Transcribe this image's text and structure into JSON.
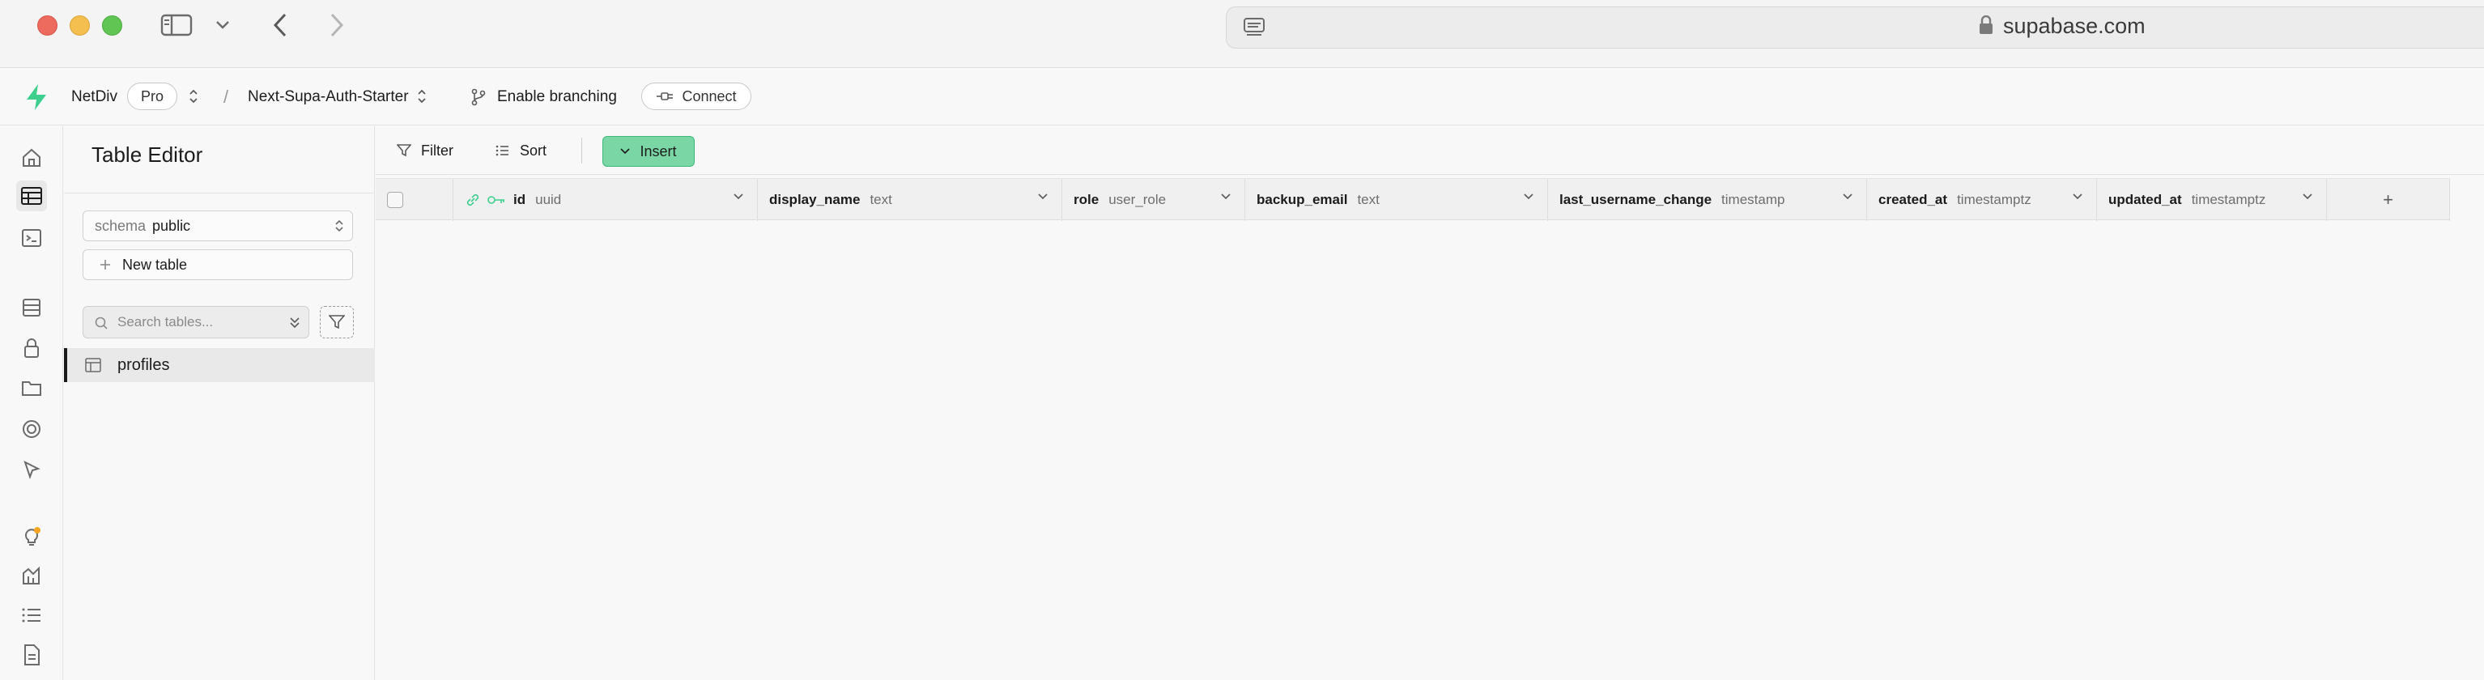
{
  "browser": {
    "url": "supabase.com"
  },
  "header": {
    "org": "NetDiv",
    "plan": "Pro",
    "separator": "/",
    "project": "Next-Supa-Auth-Starter",
    "branching_label": "Enable branching",
    "connect_label": "Connect"
  },
  "sidebar": {
    "title": "Table Editor",
    "schema_prefix": "schema",
    "schema_value": "public",
    "new_table_label": "New table",
    "search_placeholder": "Search tables...",
    "tables": [
      "profiles"
    ]
  },
  "toolbar": {
    "filter_label": "Filter",
    "sort_label": "Sort",
    "insert_label": "Insert"
  },
  "columns": [
    {
      "name": "id",
      "type": "uuid"
    },
    {
      "name": "display_name",
      "type": "text"
    },
    {
      "name": "role",
      "type": "user_role"
    },
    {
      "name": "backup_email",
      "type": "text"
    },
    {
      "name": "last_username_change",
      "type": "timestamp"
    },
    {
      "name": "created_at",
      "type": "timestamptz"
    },
    {
      "name": "updated_at",
      "type": "timestamptz"
    }
  ],
  "add_column_symbol": "+",
  "colors": {
    "accent_green": "#3ecf8e",
    "insert_bg": "#7ad6a4",
    "notification_dot": "#f5a623"
  },
  "icons": [
    "sidebar-toggle-icon",
    "back-icon",
    "forward-icon",
    "reader-icon",
    "lock-icon",
    "supabase-logo-icon",
    "branch-icon",
    "plug-icon",
    "home-icon",
    "table-editor-icon",
    "sql-editor-icon",
    "database-icon",
    "auth-icon",
    "storage-icon",
    "realtime-icon",
    "edge-functions-icon",
    "advisors-icon",
    "reports-icon",
    "logs-icon",
    "docs-icon",
    "filter-icon",
    "sort-icon",
    "search-icon",
    "link-icon",
    "key-icon"
  ]
}
